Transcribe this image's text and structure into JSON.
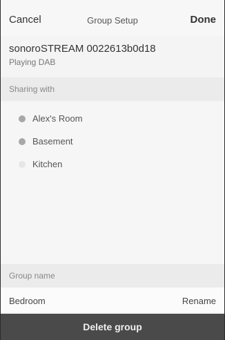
{
  "navbar": {
    "cancel_label": "Cancel",
    "title": "Group Setup",
    "done_label": "Done"
  },
  "device": {
    "name": "sonoroSTREAM 0022613b0d18",
    "status": "Playing DAB"
  },
  "sharing": {
    "header": "Sharing with",
    "rooms": [
      {
        "label": "Alex's Room",
        "selected": true
      },
      {
        "label": "Basement",
        "selected": true
      },
      {
        "label": "Kitchen",
        "selected": false
      }
    ]
  },
  "group": {
    "header": "Group name",
    "value": "Bedroom",
    "rename_label": "Rename"
  },
  "footer": {
    "delete_label": "Delete group"
  }
}
